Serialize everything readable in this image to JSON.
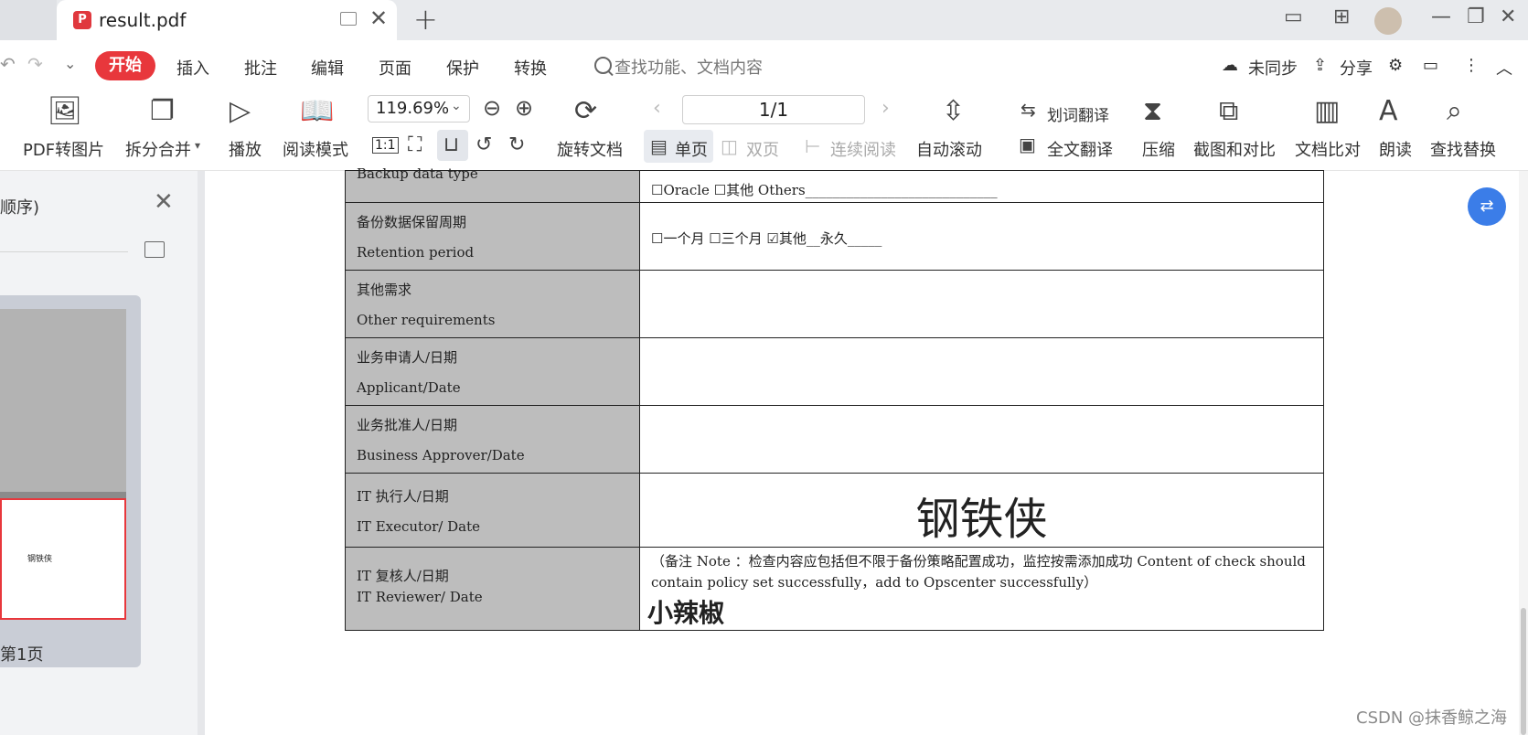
{
  "window": {
    "tab_title": "result.pdf"
  },
  "menu": {
    "active": "开始",
    "items": [
      "插入",
      "批注",
      "编辑",
      "页面",
      "保护",
      "转换"
    ],
    "search_placeholder": "查找功能、文档内容",
    "sync": "未同步",
    "share": "分享"
  },
  "ribbon": {
    "pdf_to_image": "PDF转图片",
    "split_merge": "拆分合并",
    "play": "播放",
    "read_mode": "阅读模式",
    "zoom": "119.69%",
    "actual_size": "1:1",
    "rotate_doc": "旋转文档",
    "page_indicator": "1/1",
    "single_page": "单页",
    "double_page": "双页",
    "continuous": "连续阅读",
    "auto_scroll": "自动滚动",
    "word_translate": "划词翻译",
    "full_translate": "全文翻译",
    "compress": "压缩",
    "screenshot_compare": "截图和对比",
    "doc_compare": "文档比对",
    "read_aloud": "朗读",
    "find_replace": "查找替换"
  },
  "sidebar": {
    "title": "顺序)",
    "page_label": "第1页",
    "thumb_signature": "钢铁侠"
  },
  "form": {
    "rows": [
      {
        "zh": "",
        "en": "Backup data type",
        "value": "☐Oracle          ☐其他 Others____________________________"
      },
      {
        "zh": "备份数据保留周期",
        "en": "Retention period",
        "value": "☐一个月     ☐三个月     ☑其他__永久_____"
      },
      {
        "zh": "其他需求",
        "en": "Other requirements",
        "value": ""
      },
      {
        "zh": "业务申请人/日期",
        "en": "Applicant/Date",
        "value": ""
      },
      {
        "zh": "业务批准人/日期",
        "en": "Business Approver/Date",
        "value": ""
      },
      {
        "zh": "IT 执行人/日期",
        "en": "IT Executor/ Date",
        "value": "钢铁侠"
      },
      {
        "zh": "IT 复核人/日期",
        "en": "IT Reviewer/ Date",
        "value": "（备注 Note ：检查内容应包括但不限于备份策略配置成功，监控按需添加成功 Content of check should contain policy set successfully，add to Opscenter successfully）",
        "signature": "小辣椒"
      }
    ]
  },
  "watermark": "CSDN @抹香鲸之海"
}
